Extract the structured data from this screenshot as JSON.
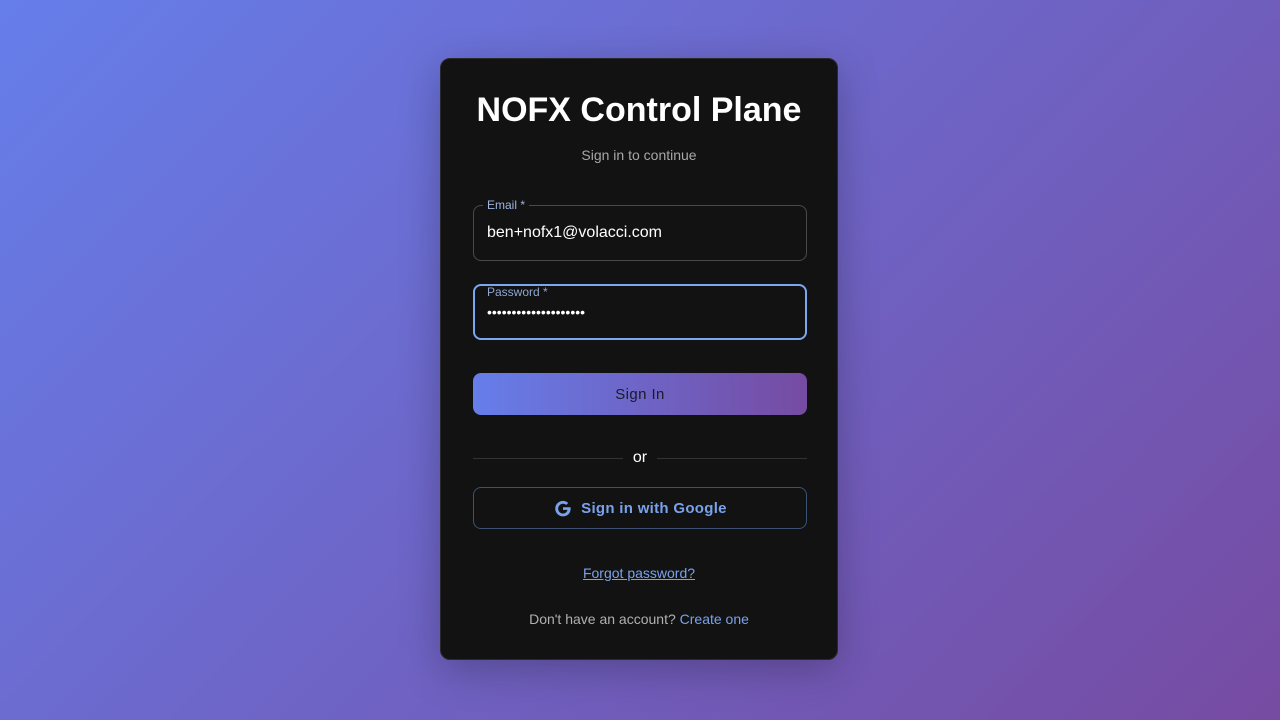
{
  "login": {
    "title": "NOFX Control Plane",
    "subtitle": "Sign in to continue",
    "email": {
      "label": "Email *",
      "value": "ben+nofx1@volacci.com"
    },
    "password": {
      "label": "Password *",
      "value": "••••••••••••••••••••"
    },
    "signin_label": "Sign In",
    "divider_text": "or",
    "google_label": "Sign in with Google",
    "forgot_label": "Forgot password?",
    "signup_prompt": "Don't have an account?",
    "signup_link": "Create one"
  },
  "colors": {
    "background_start": "#667eea",
    "background_end": "#764ba2",
    "card": "#121212",
    "accent": "#7aa2ec",
    "focus_border": "#7ba7f0"
  },
  "icons": {
    "google": "google-g-icon"
  }
}
